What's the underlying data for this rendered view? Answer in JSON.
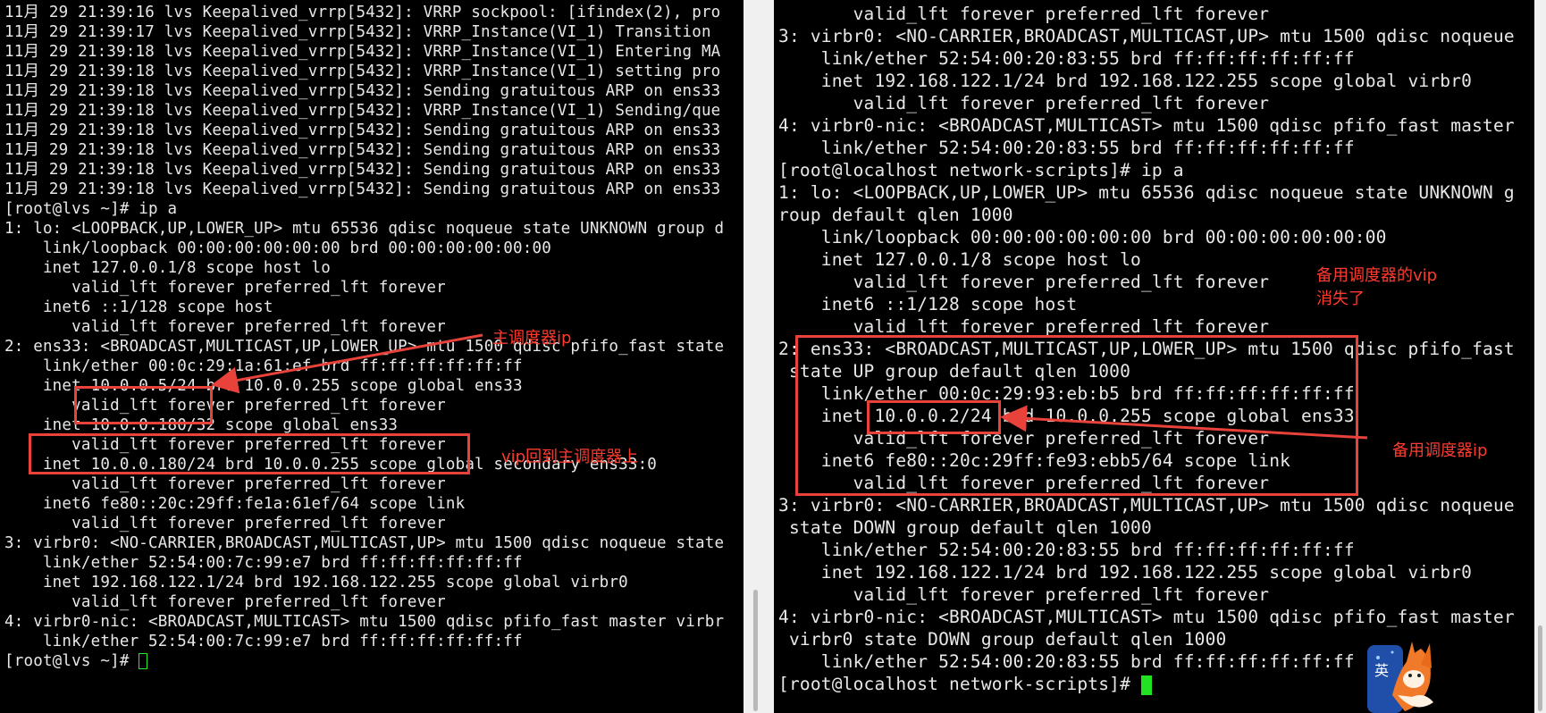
{
  "left_terminal": {
    "lines": [
      "11月 29 21:39:16 lvs Keepalived_vrrp[5432]: VRRP sockpool: [ifindex(2), pro",
      "11月 29 21:39:17 lvs Keepalived_vrrp[5432]: VRRP_Instance(VI_1) Transition",
      "11月 29 21:39:18 lvs Keepalived_vrrp[5432]: VRRP_Instance(VI_1) Entering MA",
      "11月 29 21:39:18 lvs Keepalived_vrrp[5432]: VRRP_Instance(VI_1) setting pro",
      "11月 29 21:39:18 lvs Keepalived_vrrp[5432]: Sending gratuitous ARP on ens33",
      "11月 29 21:39:18 lvs Keepalived_vrrp[5432]: VRRP_Instance(VI_1) Sending/que",
      "11月 29 21:39:18 lvs Keepalived_vrrp[5432]: Sending gratuitous ARP on ens33",
      "11月 29 21:39:18 lvs Keepalived_vrrp[5432]: Sending gratuitous ARP on ens33",
      "11月 29 21:39:18 lvs Keepalived_vrrp[5432]: Sending gratuitous ARP on ens33",
      "11月 29 21:39:18 lvs Keepalived_vrrp[5432]: Sending gratuitous ARP on ens33",
      "[root@lvs ~]# ip a",
      "1: lo: <LOOPBACK,UP,LOWER_UP> mtu 65536 qdisc noqueue state UNKNOWN group d",
      "    link/loopback 00:00:00:00:00:00 brd 00:00:00:00:00:00",
      "    inet 127.0.0.1/8 scope host lo",
      "       valid_lft forever preferred_lft forever",
      "    inet6 ::1/128 scope host",
      "       valid_lft forever preferred_lft forever",
      "2: ens33: <BROADCAST,MULTICAST,UP,LOWER_UP> mtu 1500 qdisc pfifo_fast state",
      "    link/ether 00:0c:29:1a:61:ef brd ff:ff:ff:ff:ff:ff",
      "    inet 10.0.0.5/24 brd 10.0.0.255 scope global ens33",
      "       valid_lft forever preferred_lft forever",
      "    inet 10.0.0.180/32 scope global ens33",
      "       valid_lft forever preferred_lft forever",
      "    inet 10.0.0.180/24 brd 10.0.0.255 scope global secondary ens33:0",
      "       valid_lft forever preferred_lft forever",
      "    inet6 fe80::20c:29ff:fe1a:61ef/64 scope link",
      "       valid_lft forever preferred_lft forever",
      "3: virbr0: <NO-CARRIER,BROADCAST,MULTICAST,UP> mtu 1500 qdisc noqueue state",
      "    link/ether 52:54:00:7c:99:e7 brd ff:ff:ff:ff:ff:ff",
      "    inet 192.168.122.1/24 brd 192.168.122.255 scope global virbr0",
      "       valid_lft forever preferred_lft forever",
      "4: virbr0-nic: <BROADCAST,MULTICAST> mtu 1500 qdisc pfifo_fast master virbr",
      "    link/ether 52:54:00:7c:99:e7 brd ff:ff:ff:ff:ff:ff"
    ],
    "prompt": "[root@lvs ~]# "
  },
  "right_terminal": {
    "lines": [
      "       valid_lft forever preferred_lft forever",
      "3: virbr0: <NO-CARRIER,BROADCAST,MULTICAST,UP> mtu 1500 qdisc noqueue",
      "    link/ether 52:54:00:20:83:55 brd ff:ff:ff:ff:ff:ff",
      "    inet 192.168.122.1/24 brd 192.168.122.255 scope global virbr0",
      "       valid_lft forever preferred_lft forever",
      "4: virbr0-nic: <BROADCAST,MULTICAST> mtu 1500 qdisc pfifo_fast master",
      "    link/ether 52:54:00:20:83:55 brd ff:ff:ff:ff:ff:ff",
      "[root@localhost network-scripts]# ip a",
      "1: lo: <LOOPBACK,UP,LOWER_UP> mtu 65536 qdisc noqueue state UNKNOWN g",
      "roup default qlen 1000",
      "    link/loopback 00:00:00:00:00:00 brd 00:00:00:00:00:00",
      "    inet 127.0.0.1/8 scope host lo",
      "       valid_lft forever preferred_lft forever",
      "    inet6 ::1/128 scope host",
      "       valid_lft forever preferred_lft forever",
      "2: ens33: <BROADCAST,MULTICAST,UP,LOWER_UP> mtu 1500 qdisc pfifo_fast",
      " state UP group default qlen 1000",
      "    link/ether 00:0c:29:93:eb:b5 brd ff:ff:ff:ff:ff:ff",
      "    inet 10.0.0.2/24 brd 10.0.0.255 scope global ens33",
      "       valid_lft forever preferred_lft forever",
      "    inet6 fe80::20c:29ff:fe93:ebb5/64 scope link",
      "       valid_lft forever preferred_lft forever",
      "3: virbr0: <NO-CARRIER,BROADCAST,MULTICAST,UP> mtu 1500 qdisc noqueue",
      " state DOWN group default qlen 1000",
      "    link/ether 52:54:00:20:83:55 brd ff:ff:ff:ff:ff:ff",
      "    inet 192.168.122.1/24 brd 192.168.122.255 scope global virbr0",
      "       valid_lft forever preferred_lft forever",
      "4: virbr0-nic: <BROADCAST,MULTICAST> mtu 1500 qdisc pfifo_fast master",
      " virbr0 state DOWN group default qlen 1000",
      "    link/ether 52:54:00:20:83:55 brd ff:ff:ff:ff:ff:ff"
    ],
    "prompt": "[root@localhost network-scripts]# "
  },
  "annotations": {
    "main_ip": "主调度器ip",
    "vip_back": "vip回到主调度器上",
    "backup_vip_gone": "备用调度器的vip\n消失了",
    "backup_ip": "备用调度器ip"
  },
  "colors": {
    "terminal_bg": "#000000",
    "terminal_fg": "#e8e8e8",
    "annotation": "#ff3a2e",
    "cursor": "#22e022"
  },
  "icons": {
    "mascot": "fox-mascot-icon"
  }
}
